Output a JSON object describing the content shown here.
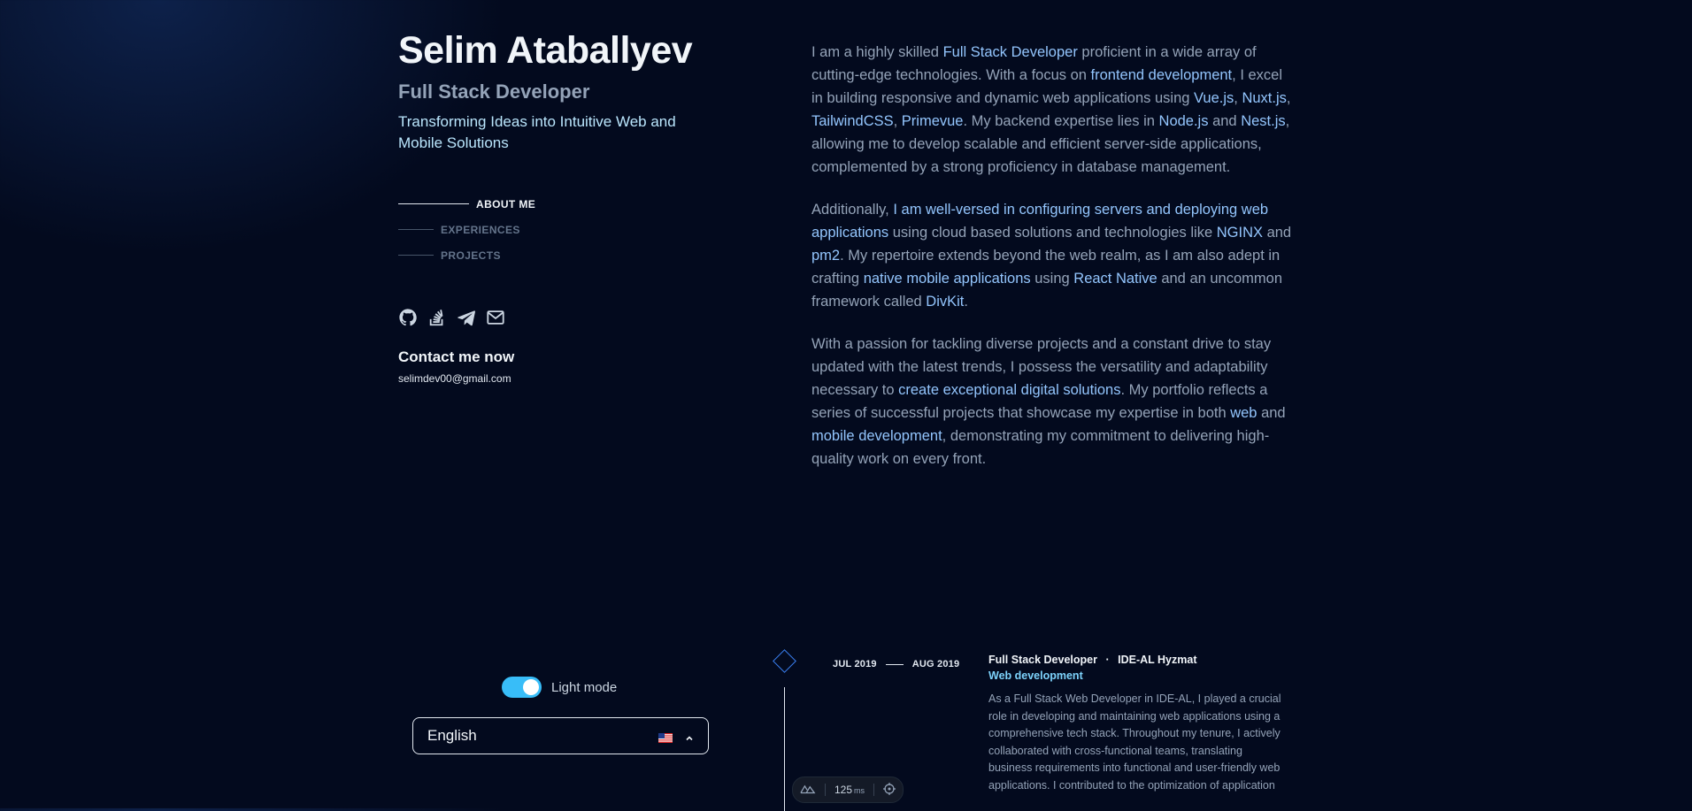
{
  "profile": {
    "name": "Selim Ataballyev",
    "role": "Full Stack Developer",
    "tagline": "Transforming Ideas into Intuitive Web and Mobile Solutions"
  },
  "nav": {
    "items": [
      {
        "label": "ABOUT ME",
        "active": true
      },
      {
        "label": "EXPERIENCES",
        "active": false
      },
      {
        "label": "PROJECTS",
        "active": false
      }
    ]
  },
  "socials": [
    "github-icon",
    "stackoverflow-icon",
    "telegram-icon",
    "mail-icon"
  ],
  "contact": {
    "title": "Contact me now",
    "email": "selimdev00@gmail.com"
  },
  "about": {
    "p1": [
      {
        "t": "I am a highly skilled "
      },
      {
        "t": "Full Stack Developer",
        "h": true
      },
      {
        "t": " proficient in a wide array of cutting-edge technologies. With a focus on "
      },
      {
        "t": "frontend development",
        "h": true
      },
      {
        "t": ", I excel in building responsive and dynamic web applications using "
      },
      {
        "t": "Vue.js",
        "h": true
      },
      {
        "t": ", "
      },
      {
        "t": "Nuxt.js",
        "h": true
      },
      {
        "t": ", "
      },
      {
        "t": "TailwindCSS",
        "h": true
      },
      {
        "t": ", "
      },
      {
        "t": "Primevue",
        "h": true
      },
      {
        "t": ". My backend expertise lies in "
      },
      {
        "t": "Node.js",
        "h": true
      },
      {
        "t": " and "
      },
      {
        "t": "Nest.js",
        "h": true
      },
      {
        "t": ", allowing me to develop scalable and efficient server-side applications, complemented by a strong proficiency in database management."
      }
    ],
    "p2": [
      {
        "t": "Additionally, "
      },
      {
        "t": "I am well-versed in configuring servers and deploying web applications",
        "h": true
      },
      {
        "t": " using cloud based solutions and technologies like "
      },
      {
        "t": "NGINX",
        "h": true
      },
      {
        "t": " and "
      },
      {
        "t": "pm2",
        "h": true
      },
      {
        "t": ". My repertoire extends beyond the web realm, as I am also adept in crafting "
      },
      {
        "t": "native mobile applications",
        "h": true
      },
      {
        "t": " using "
      },
      {
        "t": "React Native",
        "h": true
      },
      {
        "t": " and an uncommon framework called "
      },
      {
        "t": "DivKit",
        "h": true
      },
      {
        "t": "."
      }
    ],
    "p3": [
      {
        "t": "With a passion for tackling diverse projects and a constant drive to stay updated with the latest trends, I possess the versatility and adaptability necessary to "
      },
      {
        "t": "create exceptional digital solutions",
        "h": true
      },
      {
        "t": ". My portfolio reflects a series of successful projects that showcase my expertise in both "
      },
      {
        "t": "web",
        "h": true
      },
      {
        "t": " and "
      },
      {
        "t": "mobile development",
        "h": true
      },
      {
        "t": ", demonstrating my commitment to delivering high-quality work on every front."
      }
    ]
  },
  "experience": {
    "start": "JUL 2019",
    "end": "AUG 2019",
    "title": "Full Stack Developer",
    "separator": "·",
    "company": "IDE-AL Hyzmat",
    "subtitle": "Web development",
    "description": "As a Full Stack Web Developer in IDE-AL, I played a crucial role in developing and maintaining web applications using a comprehensive tech stack. Throughout my tenure, I actively collaborated with cross-functional teams, translating business requirements into functional and user-friendly web applications. I contributed to the optimization of application"
  },
  "controls": {
    "theme_label": "Light mode",
    "theme_on": true,
    "language": "English",
    "language_flag": "us-flag-icon"
  },
  "devtools": {
    "value": "125",
    "unit": "ms"
  },
  "colors": {
    "background": "#030a1e",
    "accent": "#38bdf8",
    "highlight": "#93c5fd"
  }
}
